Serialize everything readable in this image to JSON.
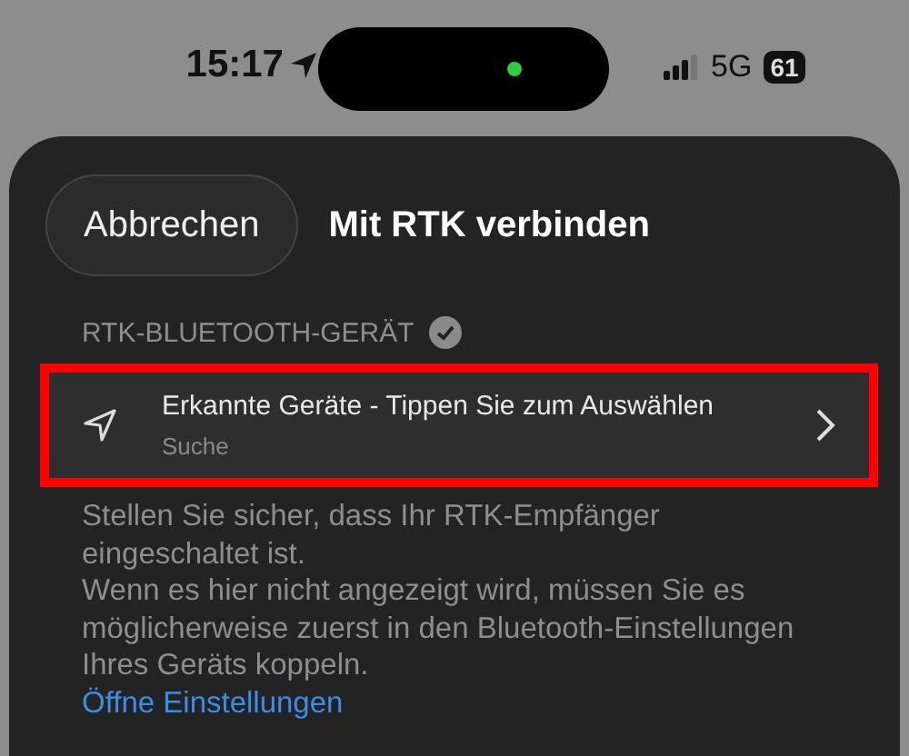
{
  "status_bar": {
    "time": "15:17",
    "network": "5G",
    "battery": "61"
  },
  "header": {
    "cancel": "Abbrechen",
    "title": "Mit RTK verbinden"
  },
  "section": {
    "title": "RTK-BLUETOOTH-GERÄT"
  },
  "device_row": {
    "title": "Erkannte Geräte - Tippen Sie zum Auswählen",
    "subtitle": "Suche",
    "highlighted": true
  },
  "help": {
    "paragraphs": [
      "Stellen Sie sicher, dass Ihr RTK-Empfänger eingeschaltet ist.",
      "Wenn es hier nicht angezeigt wird, müssen Sie es möglicherweise zuerst in den Bluetooth-Einstellungen Ihres Geräts koppeln."
    ],
    "link": "Öffne Einstellungen"
  }
}
